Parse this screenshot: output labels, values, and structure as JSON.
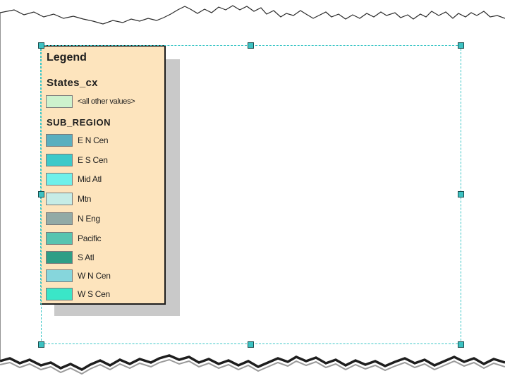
{
  "legend": {
    "title": "Legend",
    "layer_name": "States_cx",
    "other_values_label": "<all other values>",
    "other_values_color": "#cdf2cd",
    "field_name": "SUB_REGION",
    "items": [
      {
        "label": "E N Cen",
        "color": "#5aafbf"
      },
      {
        "label": "E S Cen",
        "color": "#3dc9c9"
      },
      {
        "label": "Mid Atl",
        "color": "#6ff0ea"
      },
      {
        "label": "Mtn",
        "color": "#c6ece6"
      },
      {
        "label": "N Eng",
        "color": "#92aaa6"
      },
      {
        "label": "Pacific",
        "color": "#58c4b0"
      },
      {
        "label": "S Atl",
        "color": "#2e9e86"
      },
      {
        "label": "W N Cen",
        "color": "#86d6dc"
      },
      {
        "label": "W S Cen",
        "color": "#3ae6c8"
      }
    ]
  }
}
